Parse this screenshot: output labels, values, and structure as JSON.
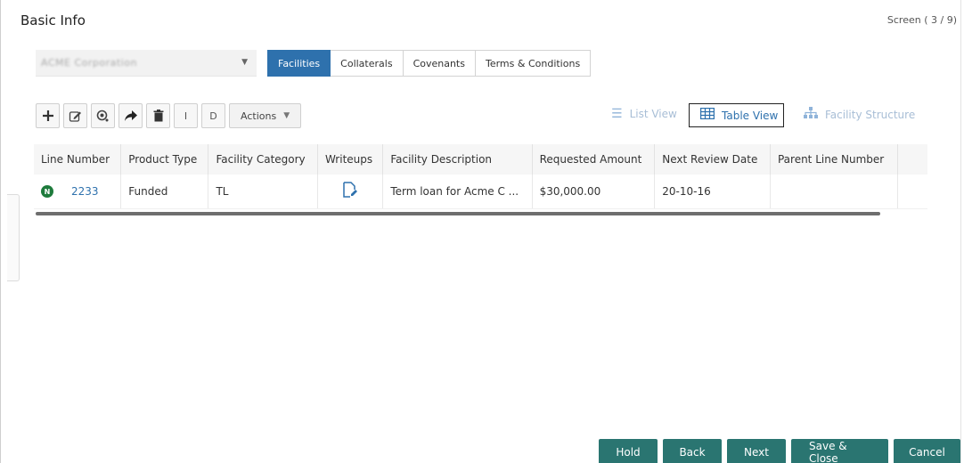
{
  "header": {
    "title": "Basic Info",
    "screen_indicator": "Screen ( 3 / 9)"
  },
  "customer_select": {
    "value": "ACME Corporation"
  },
  "tabs": [
    {
      "label": "Facilities",
      "active": true
    },
    {
      "label": "Collaterals",
      "active": false
    },
    {
      "label": "Covenants",
      "active": false
    },
    {
      "label": "Terms & Conditions",
      "active": false
    }
  ],
  "toolbar": {
    "add_icon": "plus-icon",
    "edit_icon": "edit-icon",
    "view_icon": "view-icon",
    "forward_icon": "forward-icon",
    "delete_icon": "trash-icon",
    "btn_i_label": "I",
    "btn_d_label": "D",
    "actions_label": "Actions"
  },
  "views": {
    "list": "List View",
    "table": "Table View",
    "structure": "Facility Structure"
  },
  "table": {
    "columns": [
      "Line Number",
      "Product Type",
      "Facility Category",
      "Writeups",
      "Facility Description",
      "Requested Amount",
      "Next Review Date",
      "Parent Line Number"
    ],
    "rows": [
      {
        "status": "N",
        "line_number": "2233",
        "product_type": "Funded",
        "facility_category": "TL",
        "facility_description": "Term loan for Acme C ...",
        "requested_amount": "$30,000.00",
        "next_review_date": "20-10-16",
        "parent_line_number": ""
      }
    ]
  },
  "footer": {
    "hold": "Hold",
    "back": "Back",
    "next": "Next",
    "save_close": "Save & Close",
    "cancel": "Cancel"
  },
  "colors": {
    "primary_blue": "#2e71ad",
    "footer_teal": "#2a7571",
    "status_green": "#1e7b3c"
  }
}
